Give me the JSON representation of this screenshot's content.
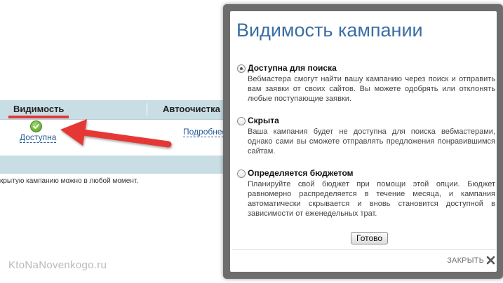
{
  "background": {
    "table_header": {
      "visibility_label": "Видимость",
      "autoclean_label": "Автоочистка ссы"
    },
    "row": {
      "status_link": "Доступна",
      "more_link": "Подробнее"
    },
    "note": "крытую кампанию можно в любой момент.",
    "watermark": "KtoNaNovenkogo.ru",
    "colors": {
      "accent_underline": "#e03a3a",
      "arrow": "#e53935",
      "header_bg": "#c9dde4"
    }
  },
  "dialog": {
    "title": "Видимость кампании",
    "options": [
      {
        "label": "Доступна для поиска",
        "description": "Вебмастера смогут найти вашу кампанию через поиск и отправить вам заявки от своих сайтов. Вы можете одобрять или отклонять любые поступающие заявки.",
        "checked": true
      },
      {
        "label": "Скрыта",
        "description": "Ваша кампания будет не доступна для поиска вебмастерами, однако сами вы сможете отправлять предложения понравившимся сайтам.",
        "checked": false
      },
      {
        "label": "Определяется бюджетом",
        "description": "Планируйте свой бюджет при помощи этой опции. Бюджет равномерно распределяется в течение месяца, и кампания автоматически скрывается и вновь становится доступной в зависимости от еженедельных трат.",
        "checked": false
      }
    ],
    "done_label": "Готово",
    "close_label": "ЗАКРЫТЬ",
    "colors": {
      "title": "#3a6da3",
      "frame": "#6d6d6d"
    }
  }
}
